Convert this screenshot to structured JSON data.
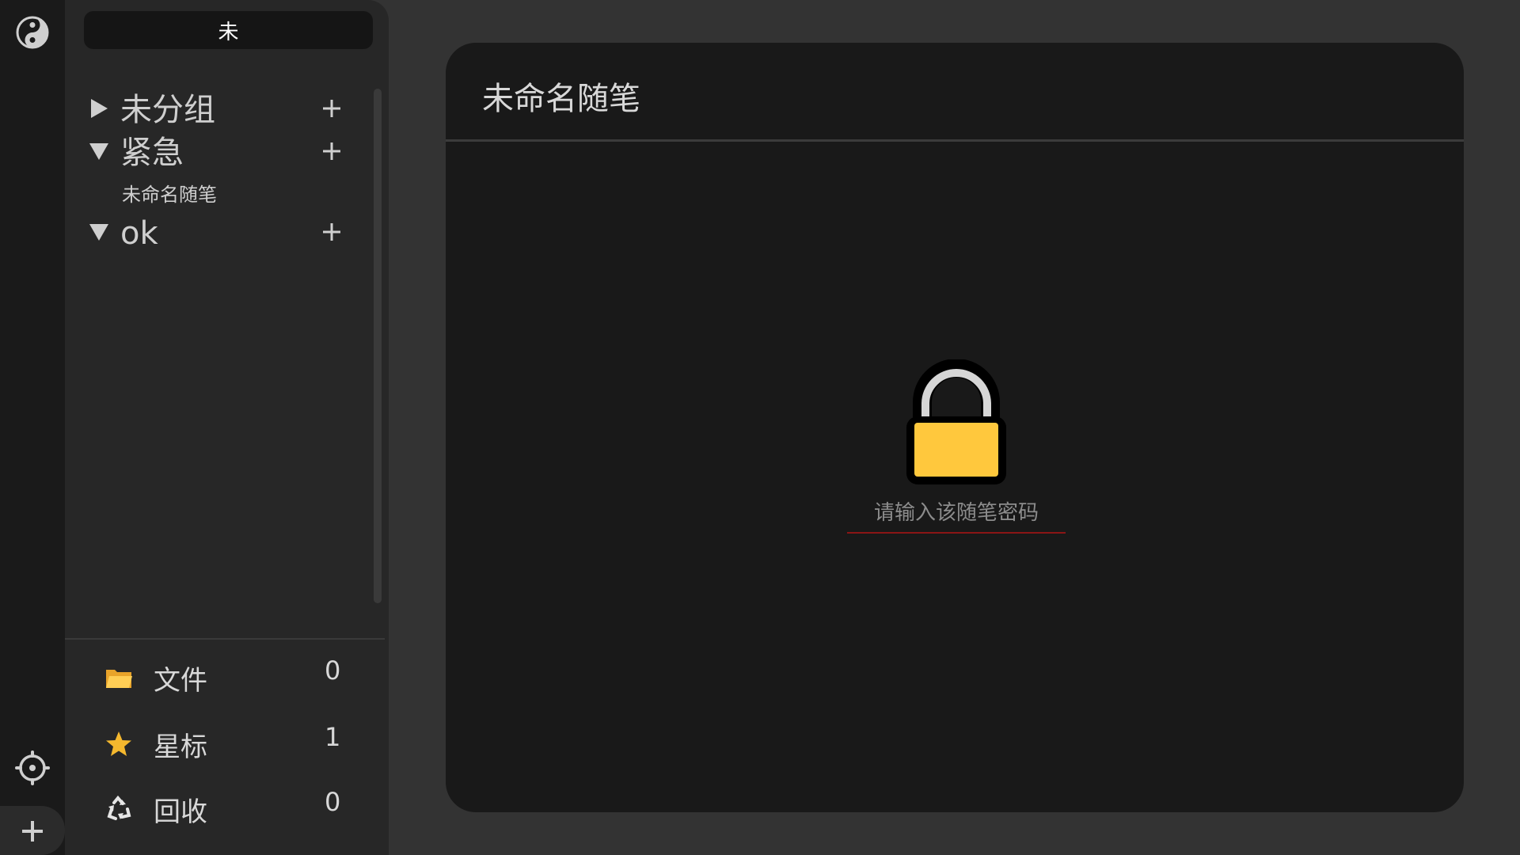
{
  "rail": {
    "logo_icon": "yin-yang-icon",
    "settings_icon": "gear-icon",
    "add_icon": "plus-icon"
  },
  "sidebar": {
    "search": {
      "value": "未"
    },
    "groups": [
      {
        "name": "未分组",
        "expanded": false,
        "add_icon": "plus-icon"
      },
      {
        "name": "紧急",
        "expanded": true,
        "add_icon": "plus-icon",
        "notes": [
          "未命名随笔"
        ]
      },
      {
        "name": "ok",
        "expanded": true,
        "add_icon": "plus-icon"
      }
    ],
    "stats": [
      {
        "label": "文件",
        "count": "0",
        "icon": "folder-icon"
      },
      {
        "label": "星标",
        "count": "1",
        "icon": "star-icon"
      },
      {
        "label": "回收",
        "count": "0",
        "icon": "recycle-icon"
      }
    ]
  },
  "main": {
    "title": "未命名随笔",
    "lock_icon": "lock-icon",
    "password_placeholder": "请输入该随笔密码"
  },
  "colors": {
    "background": "#333333",
    "rail": "#1a1a1a",
    "sidebar": "#272727",
    "panel": "#191919",
    "lock_body": "#ffc83d",
    "input_underline": "#8b1515"
  }
}
